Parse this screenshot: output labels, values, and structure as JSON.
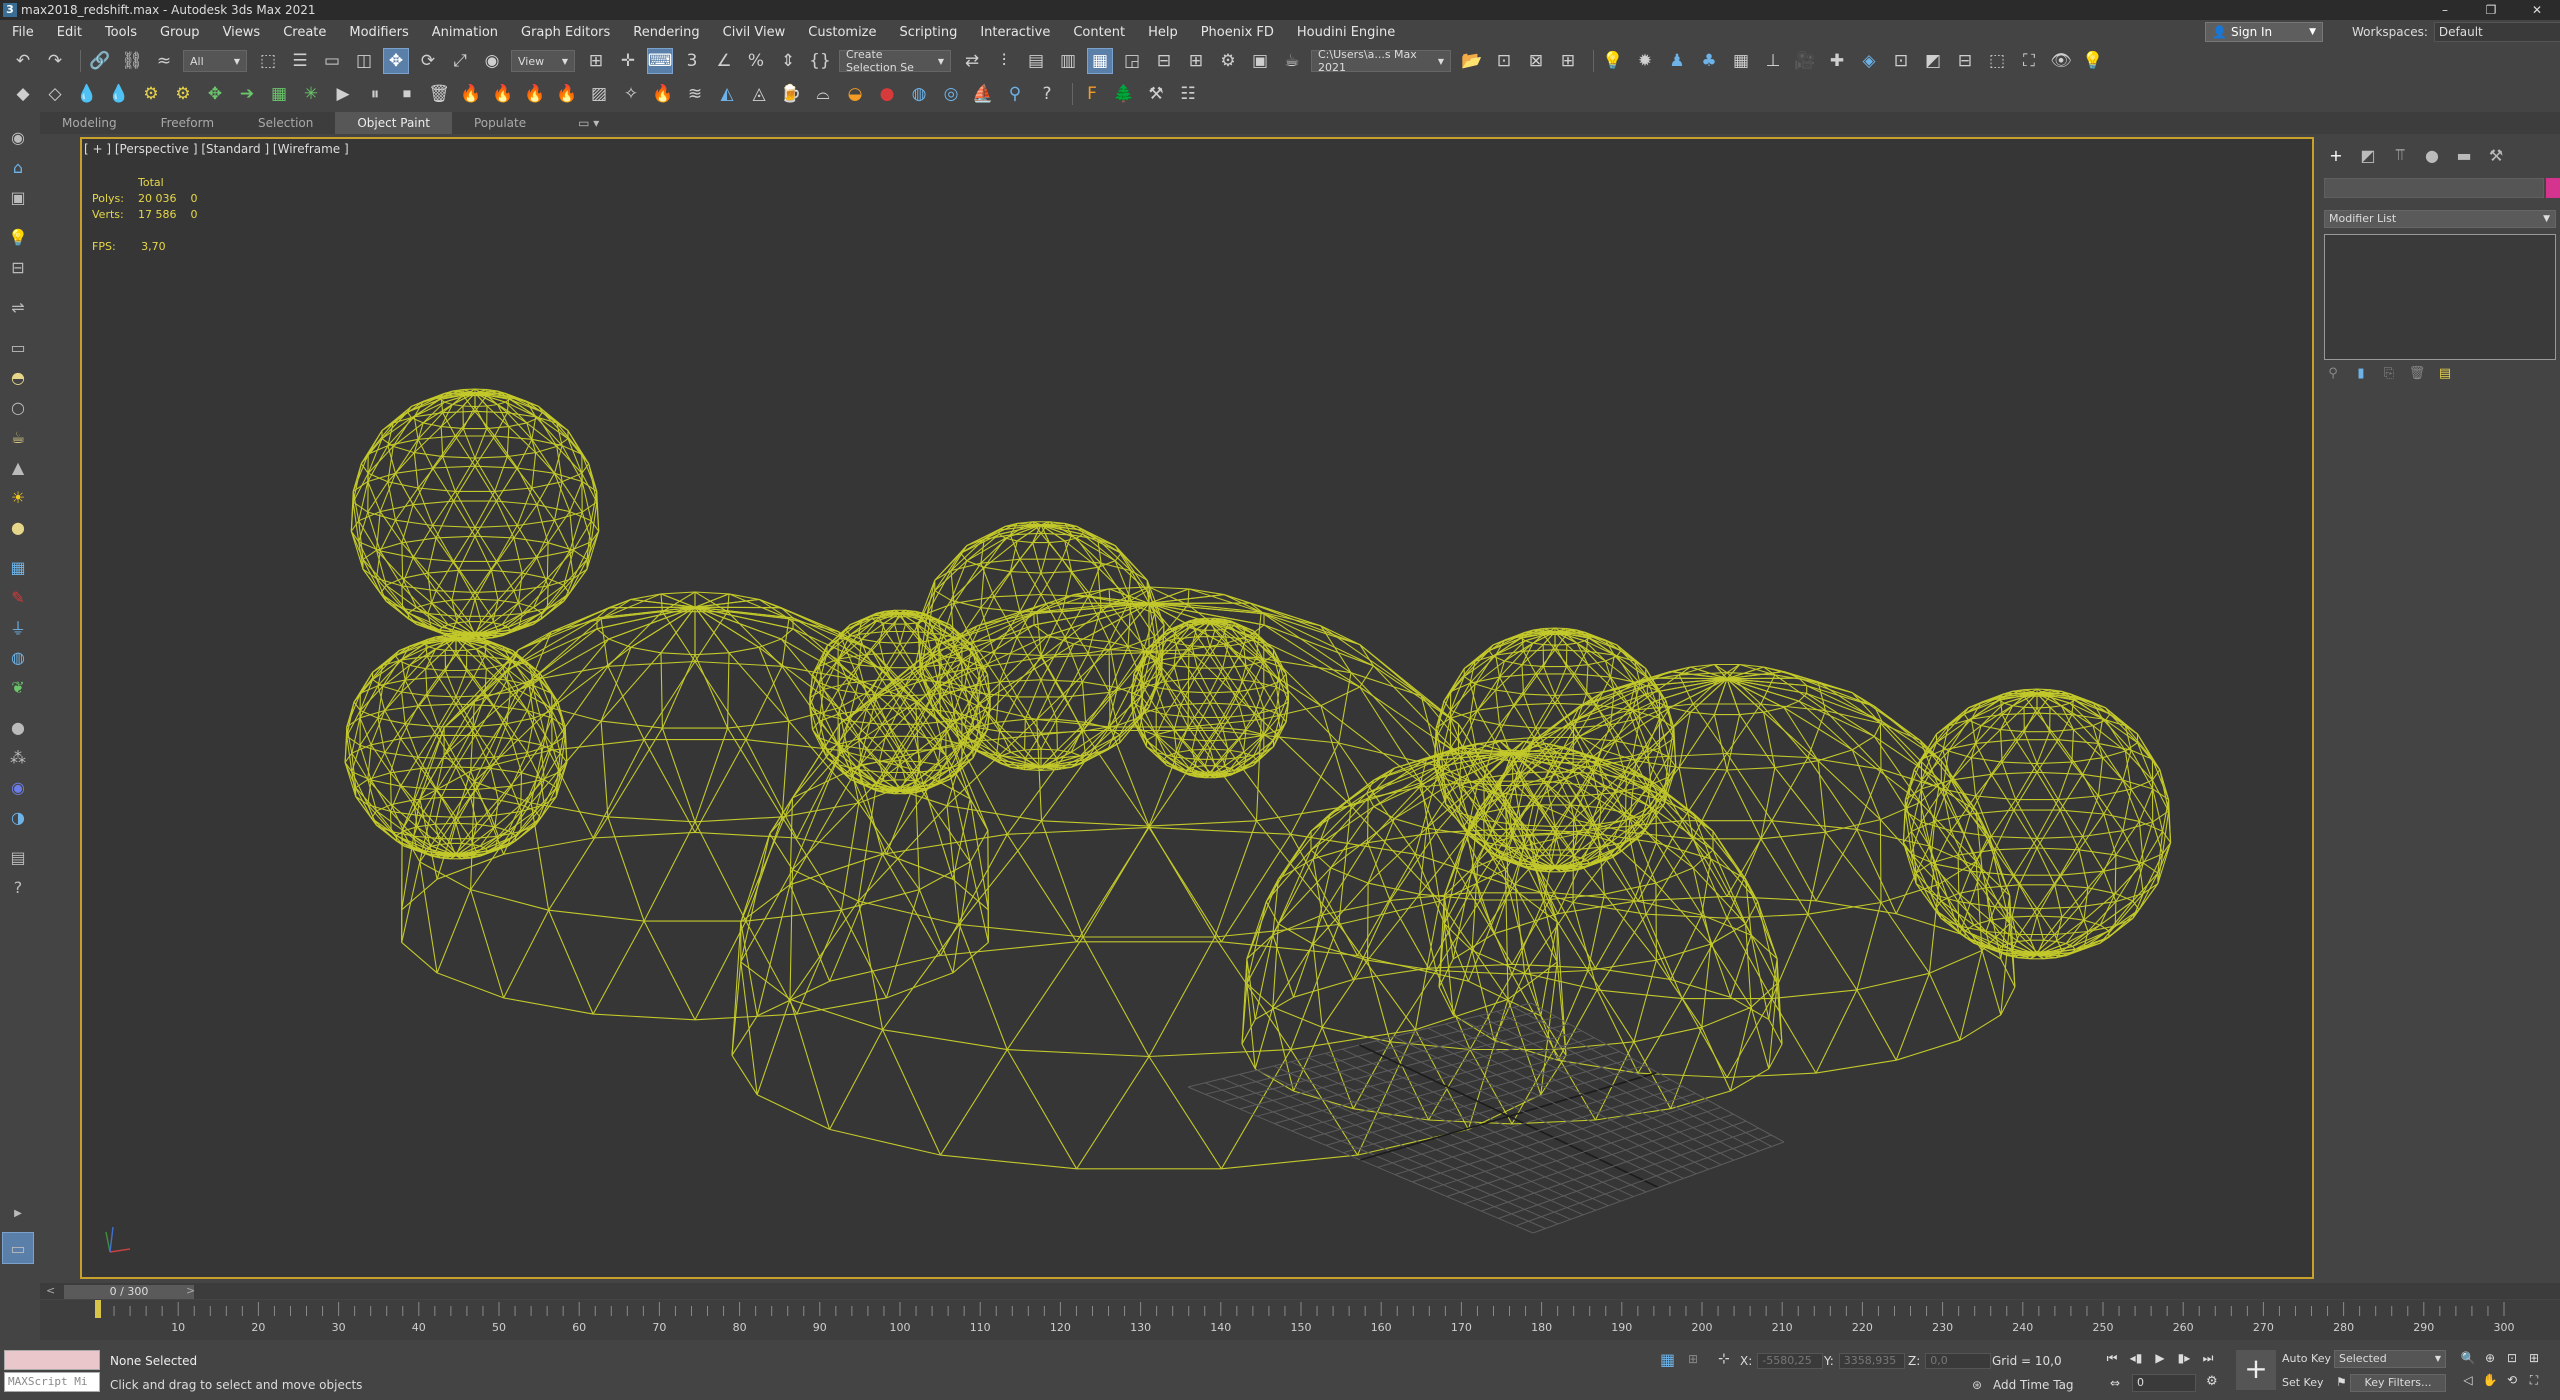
{
  "window": {
    "title": "max2018_redshift.max - Autodesk 3ds Max 2021",
    "app_icon_text": "3",
    "controls": [
      "–",
      "❐",
      "✕"
    ]
  },
  "menubar": {
    "items": [
      "File",
      "Edit",
      "Tools",
      "Group",
      "Views",
      "Create",
      "Modifiers",
      "Animation",
      "Graph Editors",
      "Rendering",
      "Civil View",
      "Customize",
      "Scripting",
      "Interactive",
      "Content",
      "Help",
      "Phoenix FD",
      "Houdini Engine"
    ],
    "sign_in": "Sign In",
    "workspaces_label": "Workspaces:",
    "workspaces_value": "Default"
  },
  "toolbar": {
    "filter_value": "All",
    "refcoord_value": "View",
    "selection_set": "Create Selection Se",
    "project_path": "C:\\Users\\a...s Max 2021"
  },
  "ribbon": {
    "tabs": [
      "Modeling",
      "Freeform",
      "Selection",
      "Object Paint",
      "Populate"
    ],
    "active_tab": "Object Paint"
  },
  "viewport": {
    "label": "[ + ] [Perspective ] [Standard ] [Wireframe ]",
    "stats": {
      "total_header": "Total",
      "polys_label": "Polys:",
      "polys_value": "20 036",
      "polys_sel": "0",
      "verts_label": "Verts:",
      "verts_value": "17 586",
      "verts_sel": "0",
      "fps_label": "FPS:",
      "fps_value": "3,70"
    },
    "wire_color": "#c3c92a",
    "border_color": "#c8a02a"
  },
  "command_panel": {
    "modifier_list": "Modifier List",
    "object_color": "#d4338e"
  },
  "timeslider": {
    "position": "0 / 300",
    "start": 0,
    "end": 300,
    "left_arrow": "<",
    "right_arrow": ">"
  },
  "trackbar": {
    "ticks": [
      0,
      10,
      20,
      30,
      40,
      50,
      60,
      70,
      80,
      90,
      100,
      110,
      120,
      130,
      140,
      150,
      160,
      170,
      180,
      190,
      200,
      210,
      220,
      230,
      240,
      250,
      260,
      270,
      280,
      290,
      300
    ]
  },
  "statusbar": {
    "listener_placeholder": "MAXScript Mi",
    "selection": "None Selected",
    "prompt": "Click and drag to select and move objects",
    "x_label": "X:",
    "x_value": "-5580,25",
    "y_label": "Y:",
    "y_value": "3358,935",
    "z_label": "Z:",
    "z_value": "0,0",
    "grid": "Grid = 10,0",
    "add_time_tag": "Add Time Tag",
    "frame_value": "0",
    "auto_key": "Auto Key",
    "set_key": "Set Key",
    "selected_value": "Selected",
    "key_filters": "Key Filters..."
  }
}
